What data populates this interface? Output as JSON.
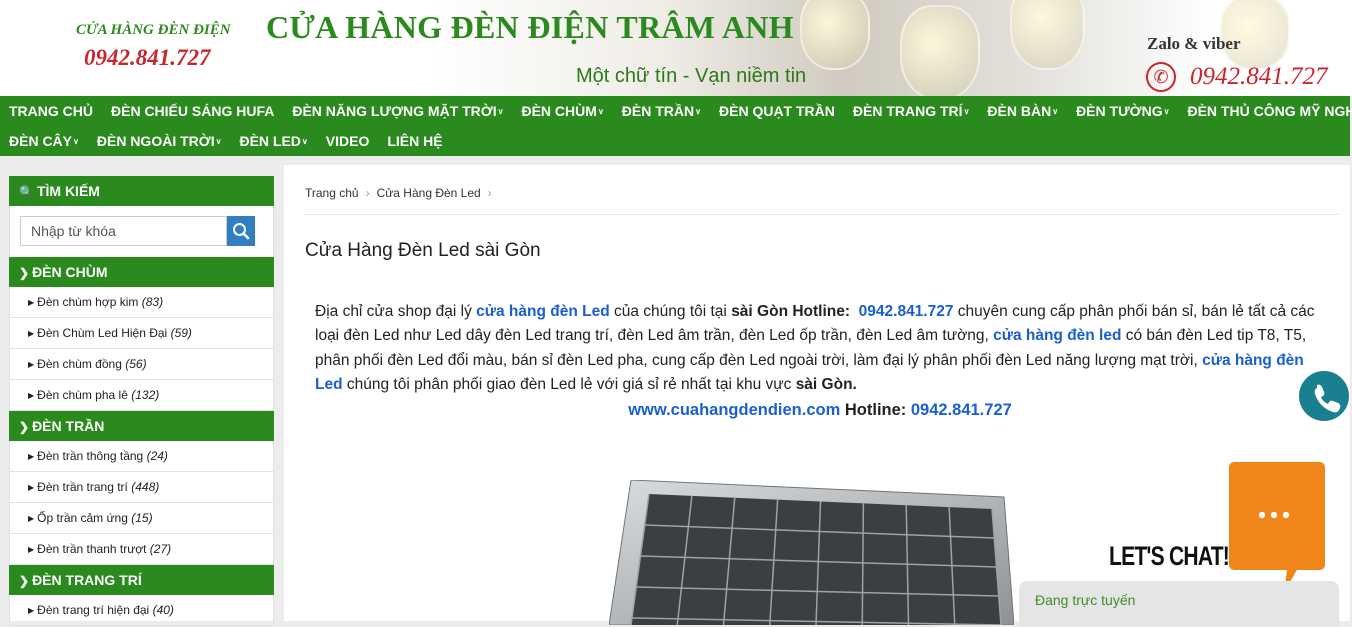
{
  "header": {
    "logo_small_name": "CỬA HÀNG ĐÈN ĐIỆN",
    "logo_small_phone": "0942.841.727",
    "title": "CỬA HÀNG ĐÈN ĐIỆN TRÂM ANH",
    "slogan": "Một chữ tín - Vạn niềm tin",
    "zalo_label": "Zalo & viber",
    "phone": "0942.841.727"
  },
  "nav": {
    "row1": [
      {
        "label": "TRANG CHỦ",
        "caret": false
      },
      {
        "label": "ĐÈN CHIẾU SÁNG HUFA",
        "caret": false
      },
      {
        "label": "ĐÈN NĂNG LƯỢNG MẶT TRỜI",
        "caret": true
      },
      {
        "label": "ĐÈN CHÙM",
        "caret": true
      },
      {
        "label": "ĐÈN TRẦN",
        "caret": true
      },
      {
        "label": "ĐÈN QUẠT TRẦN",
        "caret": false
      },
      {
        "label": "ĐÈN TRANG TRÍ",
        "caret": true
      },
      {
        "label": "ĐÈN BÀN",
        "caret": true
      },
      {
        "label": "ĐÈN TƯỜNG",
        "caret": true
      },
      {
        "label": "ĐÈN THỦ CÔNG MỸ NGHỆ",
        "caret": false
      }
    ],
    "row2": [
      {
        "label": "ĐÈN CÂY",
        "caret": true
      },
      {
        "label": "ĐÈN NGOÀI TRỜI",
        "caret": true
      },
      {
        "label": "ĐÈN LED",
        "caret": true
      },
      {
        "label": "VIDEO",
        "caret": false
      },
      {
        "label": "LIÊN HỆ",
        "caret": false
      }
    ]
  },
  "sidebar": {
    "search_title": "TÌM KIẾM",
    "search_placeholder": "Nhập từ khóa",
    "sections": [
      {
        "title": "ĐÈN CHÙM",
        "items": [
          {
            "label": "Đèn chùm hợp kim",
            "count": "(83)"
          },
          {
            "label": "Đèn Chùm Led Hiện Đại",
            "count": "(59)"
          },
          {
            "label": "Đèn chùm đồng",
            "count": "(56)"
          },
          {
            "label": "Đèn chùm pha lê",
            "count": "(132)"
          }
        ]
      },
      {
        "title": "ĐÈN TRẦN",
        "items": [
          {
            "label": "Đèn trần thông tầng",
            "count": "(24)"
          },
          {
            "label": "Đèn trần trang trí",
            "count": "(448)"
          },
          {
            "label": "Ốp trần cảm ứng",
            "count": "(15)"
          },
          {
            "label": "Đèn trần thanh trượt",
            "count": "(27)"
          }
        ]
      },
      {
        "title": "ĐÈN TRANG TRÍ",
        "items": [
          {
            "label": "Đèn trang trí hiện đại",
            "count": "(40)"
          }
        ]
      }
    ]
  },
  "main": {
    "breadcrumb": [
      "Trang chủ",
      "Cửa Hàng Đèn Led"
    ],
    "title": "Cửa Hàng Đèn Led sài Gòn",
    "paragraph": {
      "p1": "Địa chỉ cửa shop đại lý ",
      "link1": "cửa hàng đèn Led",
      "p2": " của chúng tôi tại ",
      "b1": "sài Gòn Hotline:",
      "p3": "  ",
      "link2": "0942.841.727",
      "p4": " chuyên cung cấp phân phối bán sỉ, bán lẻ tất cả các loại đèn Led như Led dây đèn Led trang trí, đèn Led âm trần, đèn Led ốp trần, đèn Led âm tường, ",
      "link3": "cửa hàng đèn led",
      "p5": " có bán đèn Led tip T8, T5, phân phối đèn Led đổi màu, bán sỉ đèn Led pha, cung cấp đèn Led ngoài trời, làm đại lý phân phối đèn Led năng lượng mạt trời, ",
      "link4": "cửa hàng đèn Led",
      "p6": " chúng tôi phân phối giao đèn Led lẻ với giá sỉ rẻ nhất tại khu vực ",
      "b2": "sài Gòn."
    },
    "website": "www.cuahangdendien.com",
    "hotline_label": " Hotline: ",
    "hotline": "0942.841.727"
  },
  "chat": {
    "lets_chat": "LET'S CHAT!",
    "status": "Đang trực tuyến"
  },
  "colors": {
    "brand_green": "#2b8a1e",
    "phone_red": "#c8262b",
    "link_blue": "#1a5fd1",
    "chat_orange": "#f0851a",
    "call_teal": "#1a7f90"
  }
}
